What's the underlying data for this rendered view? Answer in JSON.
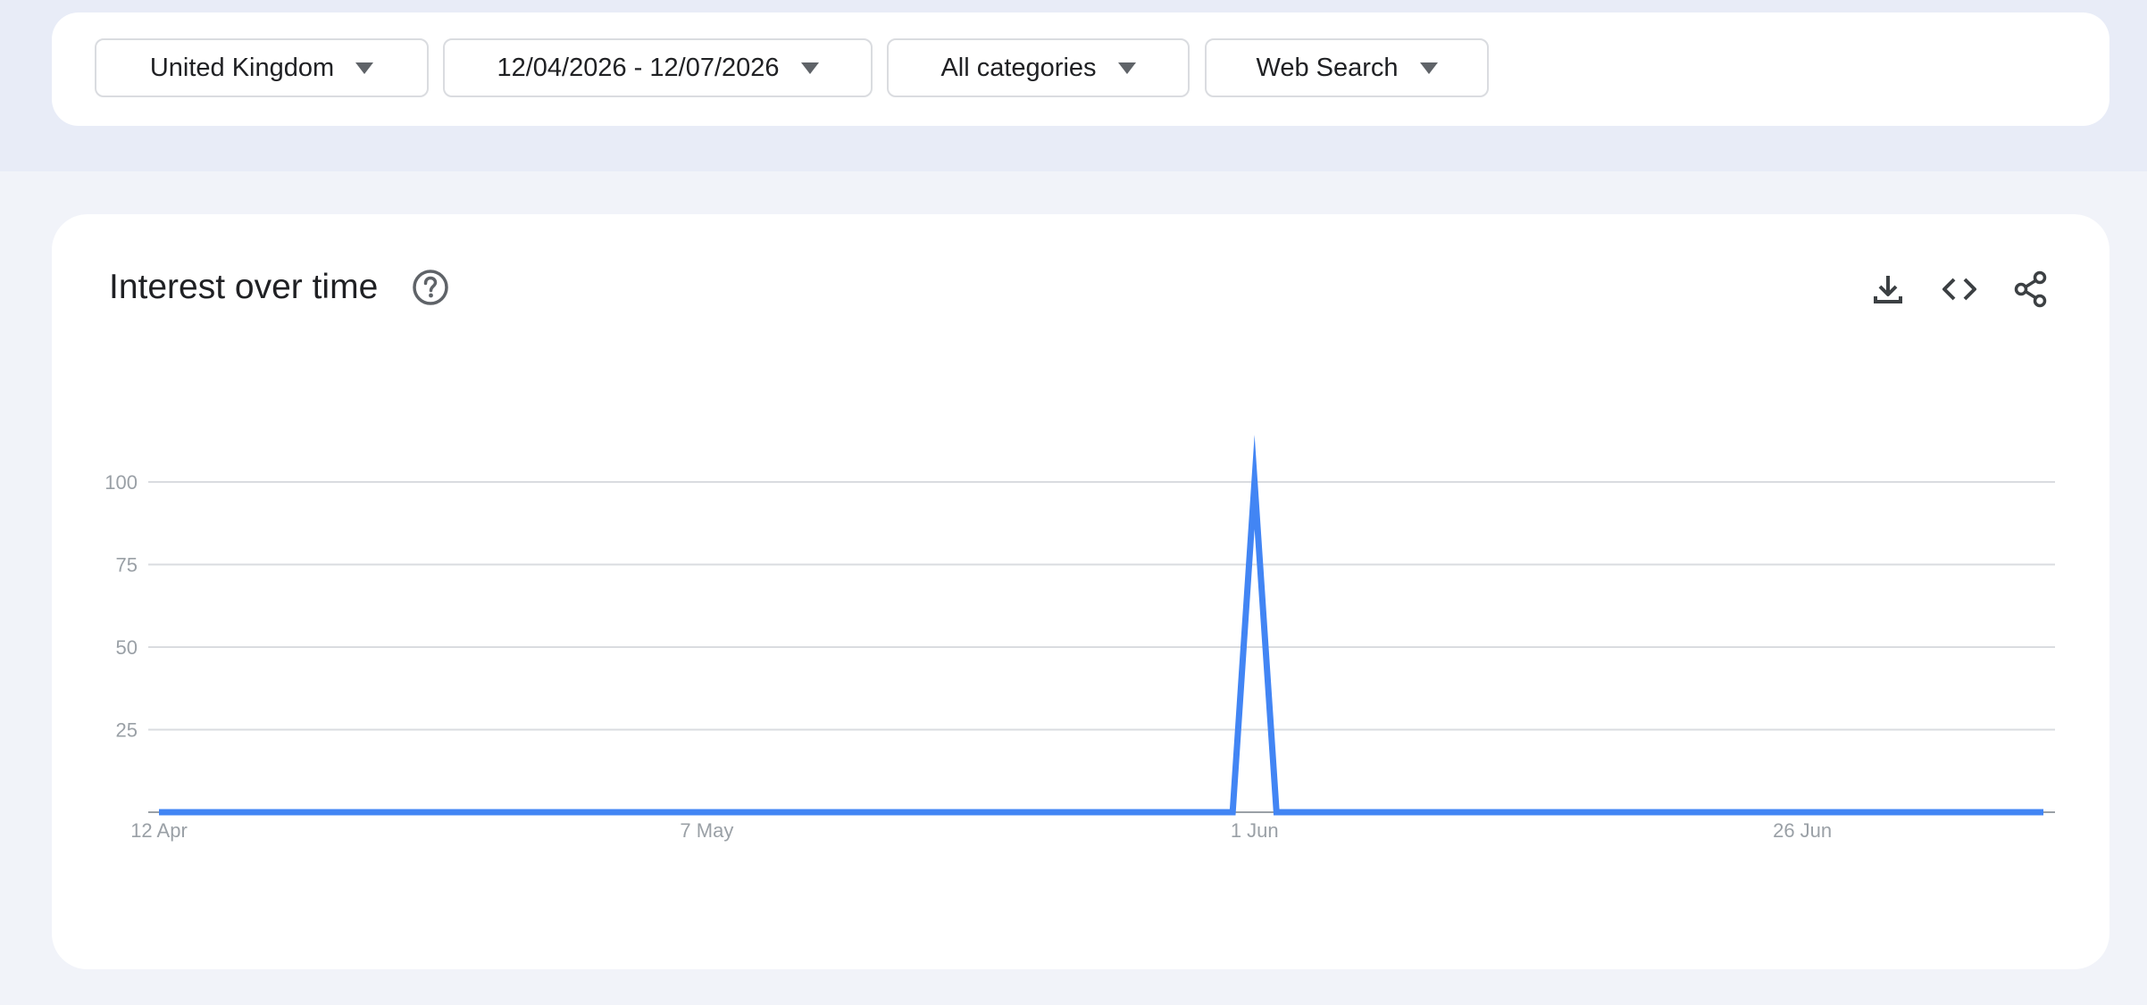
{
  "filters": {
    "region": "United Kingdom",
    "date_range": "12/04/2026 - 12/07/2026",
    "category": "All categories",
    "search_type": "Web Search"
  },
  "card": {
    "title": "Interest over time",
    "icons": {
      "help": "help-circle-icon",
      "download": "download-icon",
      "embed": "code-icon",
      "share": "share-icon"
    }
  },
  "colors": {
    "series": "#4285f4",
    "gridline": "#dadce0",
    "tick_label": "#9aa0a6"
  },
  "chart_data": {
    "type": "line",
    "title": "",
    "xlabel": "",
    "ylabel": "",
    "ylim": [
      0,
      100
    ],
    "grid": true,
    "y_ticks": [
      "100",
      "75",
      "50",
      "25"
    ],
    "x_ticks": [
      "12 Apr",
      "7 May",
      "1 Jun",
      "26 Jun"
    ],
    "x_range": [
      "2026-04-12",
      "2026-07-07"
    ],
    "series": [
      {
        "values": [
          {
            "x": "2026-04-12",
            "y": 0
          },
          {
            "x": "2026-05-31",
            "y": 0
          },
          {
            "x": "2026-06-01",
            "y": 100
          },
          {
            "x": "2026-06-02",
            "y": 0
          },
          {
            "x": "2026-07-07",
            "y": 0
          }
        ]
      }
    ]
  }
}
